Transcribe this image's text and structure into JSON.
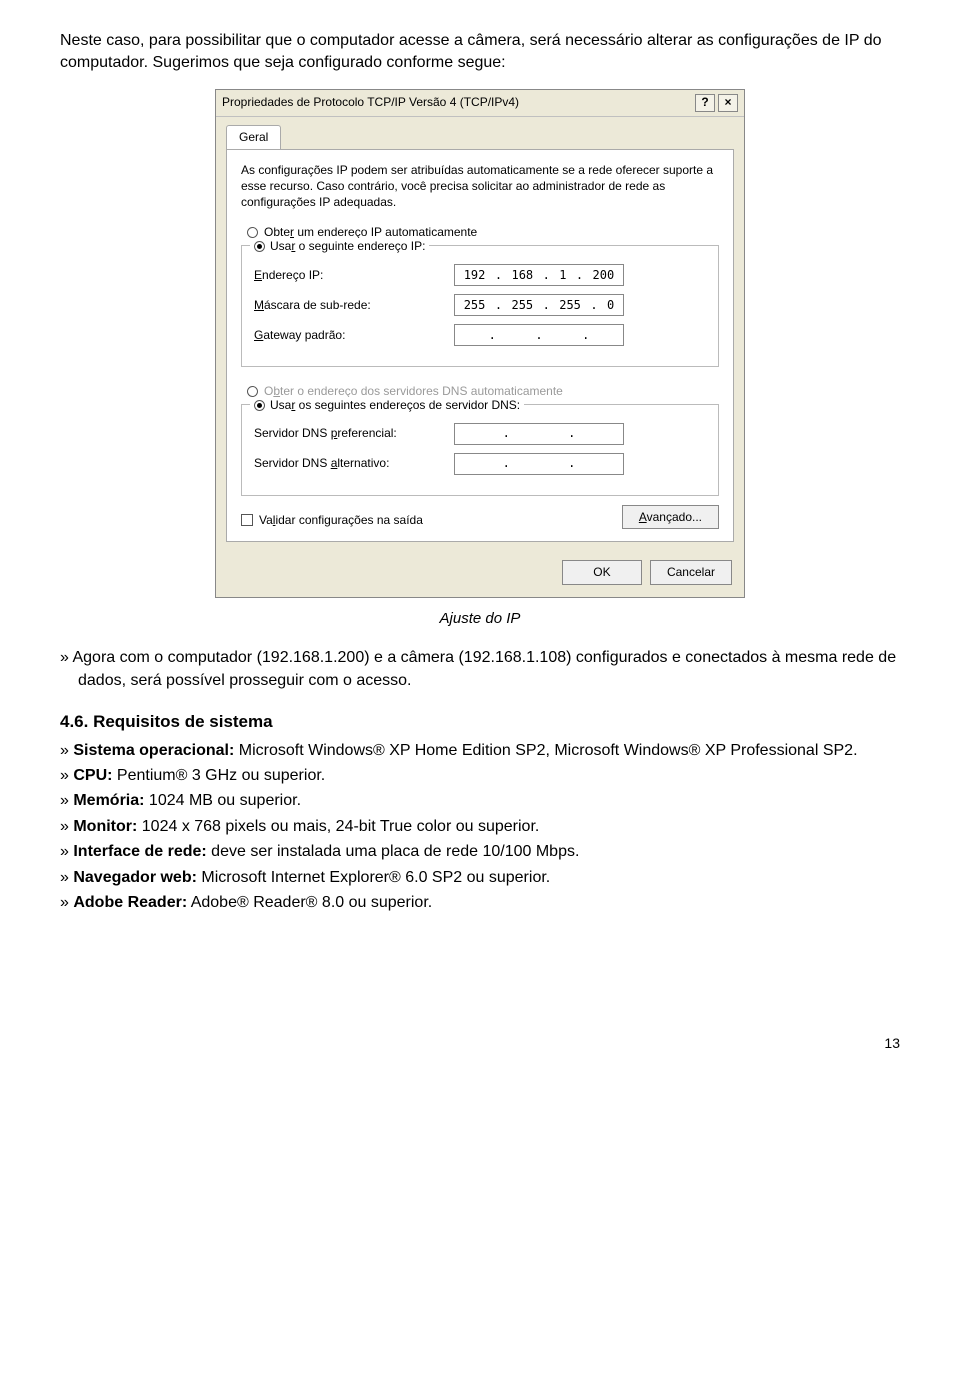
{
  "intro": "Neste caso, para possibilitar que o computador acesse a câmera, será necessário alterar as configurações de IP do computador. Sugerimos que seja configurado conforme segue:",
  "dialog": {
    "title": "Propriedades de Protocolo TCP/IP Versão 4 (TCP/IPv4)",
    "help": "?",
    "close": "×",
    "tab": "Geral",
    "desc": "As configurações IP podem ser atribuídas automaticamente se a rede oferecer suporte a esse recurso. Caso contrário, você precisa solicitar ao administrador de rede as configurações IP adequadas.",
    "radio_auto_ip": "Obter um endereço IP automaticamente",
    "radio_use_ip": "Usar o seguinte endereço IP:",
    "lbl_ip": "Endereço IP:",
    "val_ip": [
      "192",
      "168",
      "1",
      "200"
    ],
    "lbl_mask": "Máscara de sub-rede:",
    "val_mask": [
      "255",
      "255",
      "255",
      "0"
    ],
    "lbl_gw": "Gateway padrão:",
    "val_gw": [
      "",
      "",
      "",
      ""
    ],
    "radio_auto_dns": "Obter o endereço dos servidores DNS automaticamente",
    "radio_use_dns": "Usar os seguintes endereços de servidor DNS:",
    "lbl_dns1": "Servidor DNS preferencial:",
    "lbl_dns2": "Servidor DNS alternativo:",
    "chk_validate": "Validar configurações na saída",
    "btn_adv": "Avançado...",
    "btn_ok": "OK",
    "btn_cancel": "Cancelar"
  },
  "caption": "Ajuste do IP",
  "post_dialog_bullet": "Agora com o computador (192.168.1.200) e a câmera (192.168.1.108) configurados e conectados à mesma rede de dados, será possível prosseguir com o acesso.",
  "section_46": "4.6. Requisitos de sistema",
  "reqs": {
    "os_label": "Sistema operacional:",
    "os_val": " Microsoft Windows® XP Home Edition SP2, Microsoft Windows® XP Professional SP2.",
    "cpu_label": "CPU:",
    "cpu_val": " Pentium® 3 GHz ou superior.",
    "mem_label": "Memória:",
    "mem_val": " 1024 MB ou superior.",
    "mon_label": "Monitor:",
    "mon_val": " 1024 x 768 pixels ou mais, 24-bit True color ou superior.",
    "net_label": "Interface de rede:",
    "net_val": " deve ser instalada uma placa de rede 10/100 Mbps.",
    "web_label": "Navegador web:",
    "web_val": " Microsoft Internet Explorer® 6.0 SP2 ou superior.",
    "adobe_label": "Adobe Reader:",
    "adobe_val": " Adobe® Reader® 8.0 ou superior."
  },
  "pagenum": "13"
}
